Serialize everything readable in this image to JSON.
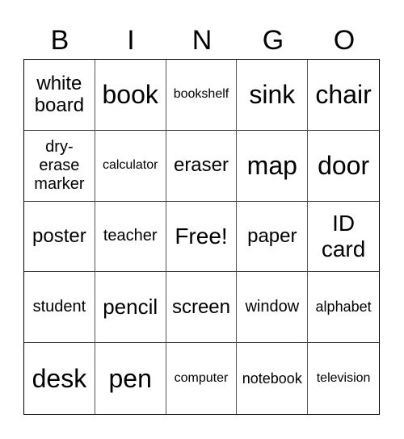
{
  "header": [
    "B",
    "I",
    "N",
    "G",
    "O"
  ],
  "cells": [
    "white board",
    "book",
    "bookshelf",
    "sink",
    "chair",
    "dry-erase marker",
    "calculator",
    "eraser",
    "map",
    "door",
    "poster",
    "teacher",
    "Free!",
    "paper",
    "ID card",
    "student",
    "pencil",
    "screen",
    "window",
    "alphabet",
    "desk",
    "pen",
    "computer",
    "notebook",
    "television"
  ]
}
